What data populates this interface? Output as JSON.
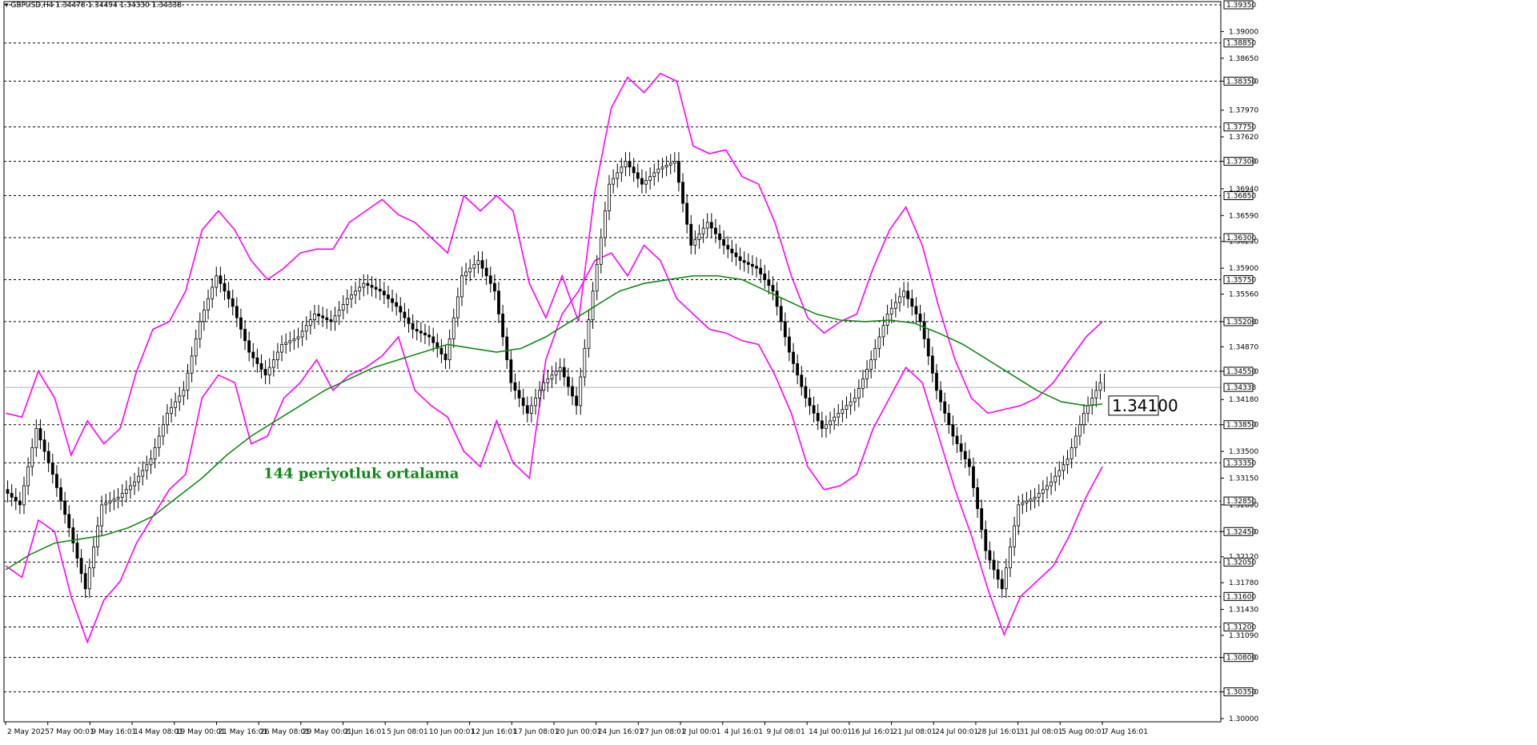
{
  "header": {
    "symbol_line": "GBPUSD,H4  1.34478  1.34494  1.34330  1.34338"
  },
  "colors": {
    "background": "#ffffff",
    "bands": "#ff00ff",
    "ma": "#138a13",
    "candles": "#000000",
    "grid": "#000000",
    "annotation": "#11871a"
  },
  "chart_data": {
    "type": "candlestick",
    "symbol": "GBPUSD",
    "timeframe": "H4",
    "ylim": [
      1.3,
      1.3935
    ],
    "price_ticks": [
      "1.39000",
      "1.38650",
      "1.38350",
      "1.37970",
      "1.37620",
      "1.37300",
      "1.36940",
      "1.36590",
      "1.36250",
      "1.35900",
      "1.35560",
      "1.35200",
      "1.34870",
      "1.34550",
      "1.34180",
      "1.33850",
      "1.33500",
      "1.33150",
      "1.32800",
      "1.32450",
      "1.32120",
      "1.31780",
      "1.31430",
      "1.31090",
      "1.30800",
      "1.30350",
      "1.30000"
    ],
    "levels": [
      "1.39350",
      "1.38850",
      "1.38350",
      "1.37750",
      "1.37300",
      "1.36850",
      "1.36300",
      "1.35750",
      "1.35200",
      "1.34550",
      "1.33850",
      "1.33350",
      "1.32850",
      "1.32450",
      "1.32050",
      "1.31600",
      "1.31200",
      "1.30800",
      "1.30350"
    ],
    "current_price": "1.34338",
    "date_labels": [
      "2 May 2025",
      "7 May 00:01",
      "9 May 16:01",
      "14 May 08:01",
      "19 May 00:01",
      "21 May 16:01",
      "26 May 08:01",
      "29 May 00:01",
      "2 Jun 16:01",
      "5 Jun 08:01",
      "10 Jun 00:01",
      "12 Jun 16:01",
      "17 Jun 08:01",
      "20 Jun 00:01",
      "24 Jun 16:01",
      "27 Jun 08:01",
      "2 Jul 00:01",
      "4 Jul 16:01",
      "9 Jul 08:01",
      "14 Jul 00:01",
      "16 Jul 16:01",
      "21 Jul 08:01",
      "24 Jul 00:01",
      "28 Jul 16:01",
      "31 Jul 08:01",
      "5 Aug 00:01",
      "7 Aug 16:01"
    ],
    "series": [
      {
        "name": "144 periyotluk ortalama",
        "kind": "moving_average",
        "points": [
          [
            0,
            1.3195
          ],
          [
            6,
            1.3215
          ],
          [
            12,
            1.323
          ],
          [
            18,
            1.3235
          ],
          [
            24,
            1.324
          ],
          [
            30,
            1.325
          ],
          [
            36,
            1.3265
          ],
          [
            42,
            1.329
          ],
          [
            48,
            1.3315
          ],
          [
            54,
            1.3345
          ],
          [
            60,
            1.337
          ],
          [
            66,
            1.339
          ],
          [
            72,
            1.341
          ],
          [
            78,
            1.343
          ],
          [
            84,
            1.3445
          ],
          [
            90,
            1.346
          ],
          [
            96,
            1.347
          ],
          [
            102,
            1.348
          ],
          [
            108,
            1.349
          ],
          [
            114,
            1.3485
          ],
          [
            120,
            1.348
          ],
          [
            126,
            1.3485
          ],
          [
            132,
            1.35
          ],
          [
            138,
            1.352
          ],
          [
            144,
            1.354
          ],
          [
            150,
            1.356
          ],
          [
            156,
            1.357
          ],
          [
            162,
            1.3575
          ],
          [
            168,
            1.358
          ],
          [
            174,
            1.358
          ],
          [
            180,
            1.3575
          ],
          [
            186,
            1.356
          ],
          [
            192,
            1.3545
          ],
          [
            198,
            1.353
          ],
          [
            204,
            1.3522
          ],
          [
            210,
            1.352
          ],
          [
            216,
            1.3522
          ],
          [
            222,
            1.3518
          ],
          [
            228,
            1.3505
          ],
          [
            234,
            1.349
          ],
          [
            240,
            1.347
          ],
          [
            246,
            1.345
          ],
          [
            252,
            1.343
          ],
          [
            258,
            1.3415
          ],
          [
            264,
            1.341
          ],
          [
            268,
            1.3412
          ]
        ]
      },
      {
        "name": "",
        "kind": "upper_band",
        "points": [
          [
            0,
            1.34
          ],
          [
            4,
            1.3395
          ],
          [
            8,
            1.3455
          ],
          [
            12,
            1.342
          ],
          [
            16,
            1.3345
          ],
          [
            20,
            1.339
          ],
          [
            24,
            1.336
          ],
          [
            28,
            1.338
          ],
          [
            32,
            1.3455
          ],
          [
            36,
            1.351
          ],
          [
            40,
            1.352
          ],
          [
            44,
            1.356
          ],
          [
            48,
            1.364
          ],
          [
            52,
            1.3665
          ],
          [
            56,
            1.364
          ],
          [
            60,
            1.36
          ],
          [
            64,
            1.3575
          ],
          [
            68,
            1.359
          ],
          [
            72,
            1.361
          ],
          [
            76,
            1.3615
          ],
          [
            80,
            1.3615
          ],
          [
            84,
            1.365
          ],
          [
            88,
            1.3665
          ],
          [
            92,
            1.368
          ],
          [
            96,
            1.366
          ],
          [
            100,
            1.365
          ],
          [
            104,
            1.363
          ],
          [
            108,
            1.361
          ],
          [
            112,
            1.3685
          ],
          [
            116,
            1.3665
          ],
          [
            120,
            1.3685
          ],
          [
            124,
            1.3665
          ],
          [
            128,
            1.357
          ],
          [
            132,
            1.3525
          ],
          [
            136,
            1.358
          ],
          [
            140,
            1.352
          ],
          [
            144,
            1.369
          ],
          [
            148,
            1.38
          ],
          [
            152,
            1.384
          ],
          [
            156,
            1.382
          ],
          [
            160,
            1.3845
          ],
          [
            164,
            1.3835
          ],
          [
            168,
            1.375
          ],
          [
            172,
            1.374
          ],
          [
            176,
            1.3745
          ],
          [
            180,
            1.371
          ],
          [
            184,
            1.37
          ],
          [
            188,
            1.365
          ],
          [
            192,
            1.358
          ],
          [
            196,
            1.3525
          ],
          [
            200,
            1.3505
          ],
          [
            204,
            1.352
          ],
          [
            208,
            1.353
          ],
          [
            212,
            1.359
          ],
          [
            216,
            1.364
          ],
          [
            220,
            1.367
          ],
          [
            224,
            1.362
          ],
          [
            228,
            1.354
          ],
          [
            232,
            1.347
          ],
          [
            236,
            1.342
          ],
          [
            240,
            1.34
          ],
          [
            244,
            1.3405
          ],
          [
            248,
            1.341
          ],
          [
            252,
            1.342
          ],
          [
            256,
            1.344
          ],
          [
            260,
            1.347
          ],
          [
            264,
            1.35
          ],
          [
            268,
            1.352
          ]
        ]
      },
      {
        "name": "",
        "kind": "lower_band",
        "points": [
          [
            0,
            1.32
          ],
          [
            4,
            1.3185
          ],
          [
            8,
            1.326
          ],
          [
            12,
            1.3245
          ],
          [
            16,
            1.316
          ],
          [
            20,
            1.31
          ],
          [
            24,
            1.3155
          ],
          [
            28,
            1.318
          ],
          [
            32,
            1.323
          ],
          [
            36,
            1.3265
          ],
          [
            40,
            1.33
          ],
          [
            44,
            1.332
          ],
          [
            48,
            1.342
          ],
          [
            52,
            1.345
          ],
          [
            56,
            1.344
          ],
          [
            60,
            1.336
          ],
          [
            64,
            1.337
          ],
          [
            68,
            1.342
          ],
          [
            72,
            1.344
          ],
          [
            76,
            1.347
          ],
          [
            80,
            1.343
          ],
          [
            84,
            1.345
          ],
          [
            88,
            1.346
          ],
          [
            92,
            1.3475
          ],
          [
            96,
            1.35
          ],
          [
            100,
            1.343
          ],
          [
            104,
            1.341
          ],
          [
            108,
            1.3395
          ],
          [
            112,
            1.335
          ],
          [
            116,
            1.333
          ],
          [
            120,
            1.339
          ],
          [
            124,
            1.3335
          ],
          [
            128,
            1.3315
          ],
          [
            132,
            1.347
          ],
          [
            136,
            1.353
          ],
          [
            140,
            1.356
          ],
          [
            144,
            1.36
          ],
          [
            148,
            1.361
          ],
          [
            152,
            1.358
          ],
          [
            156,
            1.362
          ],
          [
            160,
            1.36
          ],
          [
            164,
            1.355
          ],
          [
            168,
            1.353
          ],
          [
            172,
            1.351
          ],
          [
            176,
            1.3505
          ],
          [
            180,
            1.3495
          ],
          [
            184,
            1.349
          ],
          [
            188,
            1.345
          ],
          [
            192,
            1.34
          ],
          [
            196,
            1.333
          ],
          [
            200,
            1.33
          ],
          [
            204,
            1.3305
          ],
          [
            208,
            1.332
          ],
          [
            212,
            1.338
          ],
          [
            216,
            1.342
          ],
          [
            220,
            1.346
          ],
          [
            224,
            1.344
          ],
          [
            228,
            1.337
          ],
          [
            232,
            1.33
          ],
          [
            236,
            1.324
          ],
          [
            240,
            1.317
          ],
          [
            244,
            1.311
          ],
          [
            248,
            1.316
          ],
          [
            252,
            1.318
          ],
          [
            256,
            1.32
          ],
          [
            260,
            1.324
          ],
          [
            264,
            1.329
          ],
          [
            268,
            1.333
          ]
        ]
      },
      {
        "name": "",
        "kind": "price",
        "points": [
          [
            0,
            1.33
          ],
          [
            4,
            1.328
          ],
          [
            8,
            1.338
          ],
          [
            12,
            1.332
          ],
          [
            16,
            1.325
          ],
          [
            20,
            1.317
          ],
          [
            24,
            1.328
          ],
          [
            28,
            1.329
          ],
          [
            32,
            1.331
          ],
          [
            36,
            1.334
          ],
          [
            40,
            1.34
          ],
          [
            44,
            1.343
          ],
          [
            48,
            1.352
          ],
          [
            52,
            1.358
          ],
          [
            56,
            1.354
          ],
          [
            60,
            1.348
          ],
          [
            64,
            1.345
          ],
          [
            68,
            1.349
          ],
          [
            72,
            1.35
          ],
          [
            76,
            1.353
          ],
          [
            80,
            1.352
          ],
          [
            84,
            1.355
          ],
          [
            88,
            1.357
          ],
          [
            92,
            1.356
          ],
          [
            96,
            1.354
          ],
          [
            100,
            1.351
          ],
          [
            104,
            1.35
          ],
          [
            108,
            1.347
          ],
          [
            112,
            1.358
          ],
          [
            116,
            1.36
          ],
          [
            120,
            1.356
          ],
          [
            124,
            1.344
          ],
          [
            128,
            1.34
          ],
          [
            132,
            1.344
          ],
          [
            136,
            1.346
          ],
          [
            140,
            1.341
          ],
          [
            144,
            1.356
          ],
          [
            148,
            1.37
          ],
          [
            152,
            1.373
          ],
          [
            156,
            1.37
          ],
          [
            160,
            1.372
          ],
          [
            164,
            1.373
          ],
          [
            168,
            1.362
          ],
          [
            172,
            1.365
          ],
          [
            176,
            1.362
          ],
          [
            180,
            1.36
          ],
          [
            184,
            1.359
          ],
          [
            188,
            1.356
          ],
          [
            192,
            1.348
          ],
          [
            196,
            1.342
          ],
          [
            200,
            1.338
          ],
          [
            204,
            1.34
          ],
          [
            208,
            1.342
          ],
          [
            212,
            1.347
          ],
          [
            216,
            1.353
          ],
          [
            220,
            1.356
          ],
          [
            224,
            1.352
          ],
          [
            228,
            1.343
          ],
          [
            232,
            1.337
          ],
          [
            236,
            1.333
          ],
          [
            240,
            1.322
          ],
          [
            244,
            1.317
          ],
          [
            248,
            1.328
          ],
          [
            252,
            1.329
          ],
          [
            256,
            1.331
          ],
          [
            260,
            1.334
          ],
          [
            264,
            1.34
          ],
          [
            268,
            1.344
          ]
        ]
      }
    ],
    "annotations": [
      {
        "text": "144 periyotluk ortalama",
        "x": 63,
        "y": 1.332
      },
      {
        "text": "1.34100",
        "x": 268,
        "y": 1.341
      }
    ],
    "grid": "horizontal-dashed",
    "legend": "none"
  }
}
